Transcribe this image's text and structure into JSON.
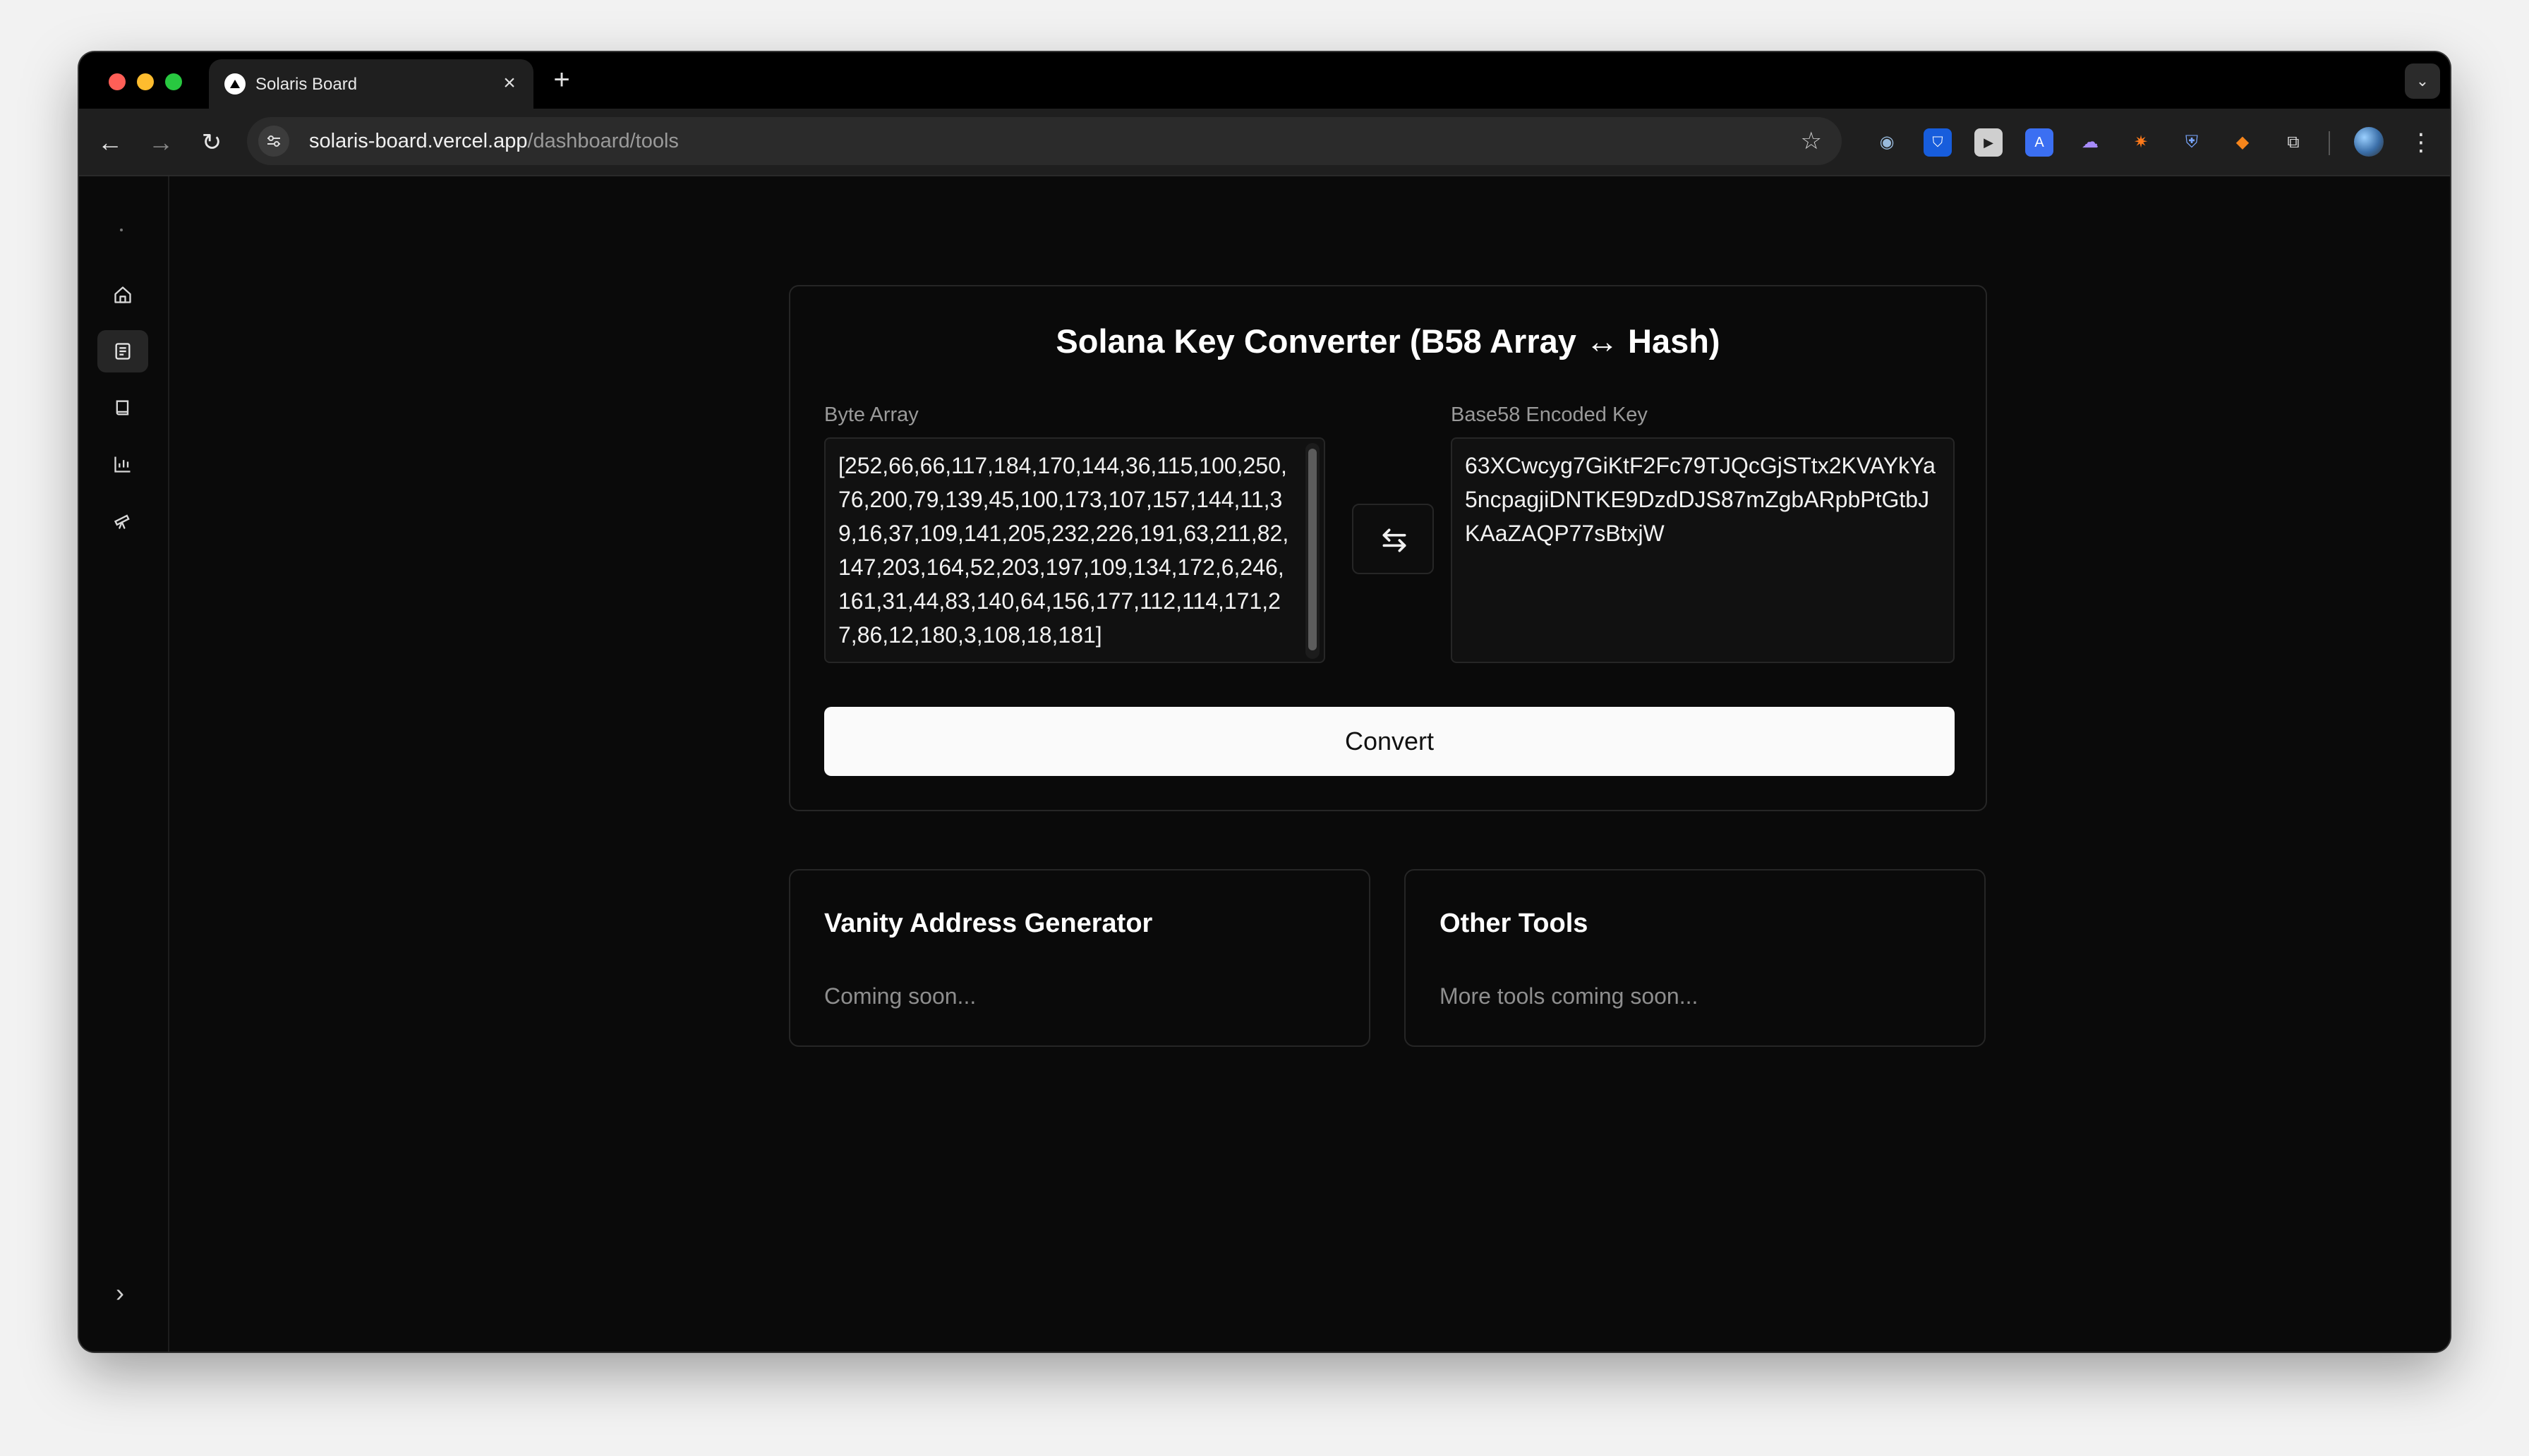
{
  "browser": {
    "tab": {
      "title": "Solaris Board",
      "close_glyph": "×"
    },
    "new_tab_glyph": "+",
    "url": {
      "host": "solaris-board.vercel.app",
      "path": "/dashboard/tools"
    },
    "extensions": [
      "glasses-extension-icon",
      "bitwarden-icon",
      "play-extension-icon",
      "translate-extension-icon",
      "ghost-extension-icon",
      "spark-extension-icon",
      "shield-extension-icon",
      "metamask-icon",
      "puzzle-extensions-icon"
    ]
  },
  "sidebar": {
    "items": [
      {
        "name": "home-icon",
        "active": false
      },
      {
        "name": "tools-icon",
        "active": true
      },
      {
        "name": "book-icon",
        "active": false
      },
      {
        "name": "analytics-icon",
        "active": false
      },
      {
        "name": "telescope-icon",
        "active": false
      }
    ],
    "expand_glyph": "›"
  },
  "converter": {
    "title": "Solana Key Converter (B58 Array ↔ Hash)",
    "byte_array_label": "Byte Array",
    "byte_array_value": "[252,66,66,117,184,170,144,36,115,100,250,76,200,79,139,45,100,173,107,157,144,11,39,16,37,109,141,205,232,226,191,63,211,82,147,203,164,52,203,197,109,134,172,6,246,161,31,44,83,140,64,156,177,112,114,171,27,86,12,180,3,108,18,181]",
    "base58_label": "Base58 Encoded Key",
    "base58_value": "63XCwcyg7GiKtF2Fc79TJQcGjSTtx2KVAYkYa5ncpagjiDNTKE9DzdDJS87mZgbARpbPtGtbJKAaZAQP77sBtxjW",
    "convert_label": "Convert"
  },
  "cards": {
    "vanity": {
      "title": "Vanity Address Generator",
      "subtitle": "Coming soon..."
    },
    "other": {
      "title": "Other Tools",
      "subtitle": "More tools coming soon..."
    }
  },
  "colors": {
    "background": "#0a0a0a",
    "card_border": "#262626",
    "button_bg": "#fafafa"
  }
}
